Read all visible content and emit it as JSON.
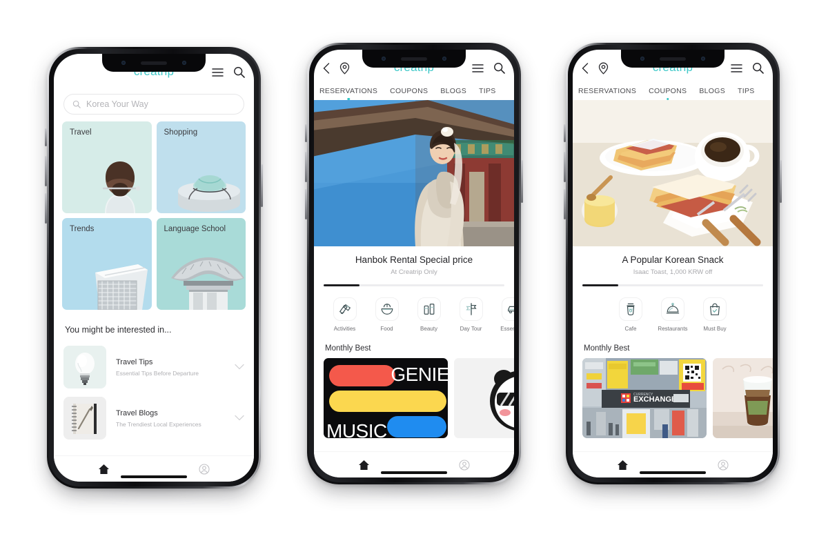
{
  "brand": {
    "name": "creatrip",
    "color": "#3ec8c8",
    "accent": "#2ec5c5"
  },
  "phones": [
    {
      "id": "phone-home",
      "appbar": {
        "logo": "creatrip",
        "menu_icon": "hamburger-menu-icon",
        "search_icon": "search-icon"
      },
      "search": {
        "placeholder": "Korea Your Way",
        "value": "",
        "icon": "search-icon"
      },
      "tiles": [
        {
          "label": "Travel",
          "color": "#d6ece8",
          "art": "woman-back-hair-pin"
        },
        {
          "label": "Shopping",
          "color": "#bfdfed",
          "art": "wrapped-gift-bojagi"
        },
        {
          "label": "Trends",
          "color": "#b3dced",
          "art": "knit-fabric-roll"
        },
        {
          "label": "Language School",
          "color": "#a9dbd8",
          "art": "hanok-roof"
        }
      ],
      "section_title": "You might be interested in...",
      "list": [
        {
          "title": "Travel Tips",
          "subtitle": "Essential Tips Before Departure",
          "thumb": "lightbulb-icon",
          "thumb_bg": "#e8f1ef"
        },
        {
          "title": "Travel Blogs",
          "subtitle": "The Trendiest Local Experiences",
          "thumb": "spiral-notebook-icon",
          "thumb_bg": "#eeeeee"
        }
      ],
      "bottomnav": [
        {
          "icon": "home-icon",
          "active": true
        },
        {
          "icon": "profile-icon",
          "active": false
        }
      ]
    },
    {
      "id": "phone-reservations",
      "appbar": {
        "logo": "creatrip",
        "back_icon": "chevron-left-icon",
        "location_icon": "location-pin-icon",
        "menu_icon": "hamburger-menu-icon",
        "search_icon": "search-icon"
      },
      "tabs": [
        {
          "label": "RESERVATIONS",
          "active": true
        },
        {
          "label": "COUPONS",
          "active": false
        },
        {
          "label": "BLOGS",
          "active": false
        },
        {
          "label": "TIPS",
          "active": false
        }
      ],
      "hero": {
        "image": "woman-in-cream-hanbok-at-palace",
        "title": "Hanbok Rental Special price",
        "subtitle": "At Creatrip Only",
        "progress_percent": 14
      },
      "quick_icons": [
        {
          "label": "Activities",
          "icon": "activities-icon"
        },
        {
          "label": "Food",
          "icon": "rice-bowl-icon"
        },
        {
          "label": "Beauty",
          "icon": "cosmetics-icon"
        },
        {
          "label": "Day Tour",
          "icon": "signpost-icon"
        },
        {
          "label": "Essentials",
          "icon": "car-icon"
        }
      ],
      "monthly_best": {
        "title": "Monthly Best",
        "cards": [
          {
            "type": "genie-music",
            "line1": "GENIE",
            "line2": "MUSIC"
          },
          {
            "type": "panda-sunglasses"
          }
        ]
      },
      "bottomnav": [
        {
          "icon": "home-icon",
          "active": true
        },
        {
          "icon": "profile-icon",
          "active": false
        }
      ]
    },
    {
      "id": "phone-coupons",
      "appbar": {
        "logo": "creatrip",
        "back_icon": "chevron-left-icon",
        "location_icon": "location-pin-icon",
        "menu_icon": "hamburger-menu-icon",
        "search_icon": "search-icon"
      },
      "tabs": [
        {
          "label": "RESERVATIONS",
          "active": false
        },
        {
          "label": "COUPONS",
          "active": true
        },
        {
          "label": "BLOGS",
          "active": false
        },
        {
          "label": "TIPS",
          "active": false
        }
      ],
      "hero": {
        "image": "korean-toast-sandwich-with-coffee",
        "title": "A Popular Korean Snack",
        "subtitle": "Isaac Toast, 1,000 KRW off",
        "progress_percent": 14
      },
      "quick_icons": [
        {
          "label": "Cafe",
          "icon": "coffee-cup-icon"
        },
        {
          "label": "Restaurants",
          "icon": "cloche-icon"
        },
        {
          "label": "Must Buy",
          "icon": "shopping-bag-icon"
        }
      ],
      "monthly_best": {
        "title": "Monthly Best",
        "cards": [
          {
            "type": "currency-exchange-storefront"
          },
          {
            "type": "iced-latte-drinks"
          }
        ]
      },
      "bottomnav": [
        {
          "icon": "home-icon",
          "active": true
        },
        {
          "icon": "profile-icon",
          "active": false
        }
      ]
    }
  ]
}
